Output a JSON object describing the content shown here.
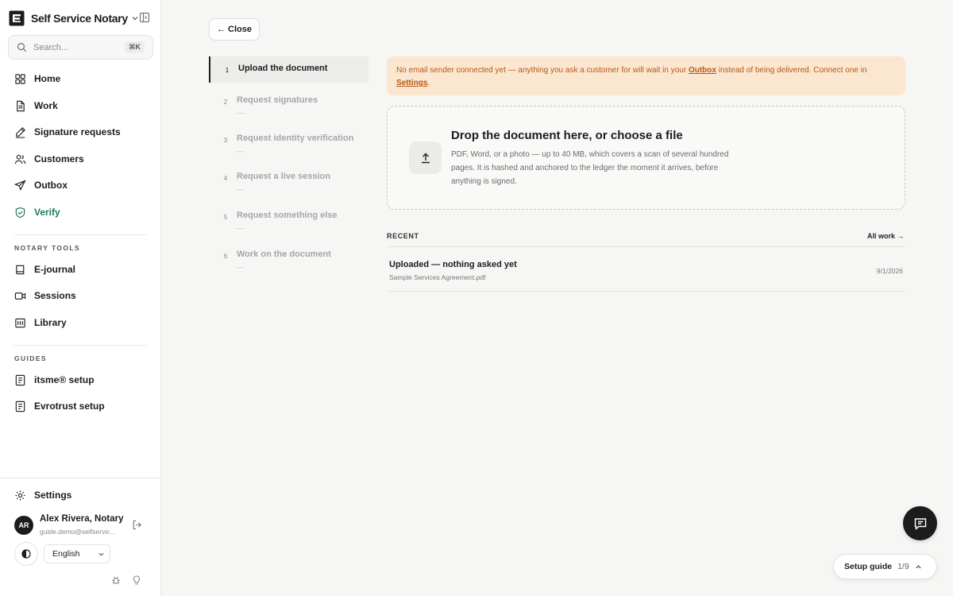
{
  "brand": {
    "name": "Self Service Notary",
    "icon": "brand-logo-icon"
  },
  "search": {
    "placeholder": "Search...",
    "shortcut": "⌘K"
  },
  "nav": {
    "main": [
      {
        "label": "Home",
        "icon": "home-grid-icon"
      },
      {
        "label": "Work",
        "icon": "document-icon"
      },
      {
        "label": "Signature requests",
        "icon": "pen-icon"
      },
      {
        "label": "Customers",
        "icon": "users-icon"
      },
      {
        "label": "Outbox",
        "icon": "send-icon"
      },
      {
        "label": "Verify",
        "icon": "shield-check-icon",
        "active": true
      }
    ],
    "tools_label": "NOTARY TOOLS",
    "tools": [
      {
        "label": "E-journal",
        "icon": "book-icon"
      },
      {
        "label": "Sessions",
        "icon": "video-icon"
      },
      {
        "label": "Library",
        "icon": "library-icon"
      }
    ],
    "guides_label": "GUIDES",
    "guides": [
      {
        "label": "itsme® setup",
        "icon": "guide-icon"
      },
      {
        "label": "Evrotrust setup",
        "icon": "guide-icon"
      }
    ],
    "settings": {
      "label": "Settings",
      "icon": "gear-icon"
    }
  },
  "user": {
    "initials": "AR",
    "name": "Alex Rivera, Notary",
    "email": "guide.demo@selfservice.notary"
  },
  "language": {
    "selected": "English"
  },
  "close_label": "← Close",
  "steps": [
    {
      "num": "1",
      "title": "Upload the document",
      "active": true
    },
    {
      "num": "2",
      "title": "Request signatures",
      "sub": "—"
    },
    {
      "num": "3",
      "title": "Request identity verification",
      "sub": "—"
    },
    {
      "num": "4",
      "title": "Request a live session",
      "sub": "—"
    },
    {
      "num": "5",
      "title": "Request something else",
      "sub": "—"
    },
    {
      "num": "6",
      "title": "Work on the document",
      "sub": "—"
    }
  ],
  "banner": {
    "text_before": "No email sender connected yet — anything you ask a customer for will wait in your ",
    "outbox_link": "Outbox",
    "text_middle": " instead of being delivered. Connect one in ",
    "settings_link": "Settings",
    "text_after": "."
  },
  "dropzone": {
    "title": "Drop the document here, or choose a file",
    "description": "PDF, Word, or a photo — up to 40 MB, which covers a scan of several hundred pages. It is hashed and anchored to the ledger the moment it arrives, before anything is signed."
  },
  "recent": {
    "label": "RECENT",
    "all_work": "All work →",
    "items": [
      {
        "title": "Uploaded — nothing asked yet",
        "file": "Sample Services Agreement.pdf",
        "date": "9/1/2026"
      }
    ]
  },
  "setup_guide": {
    "label": "Setup guide",
    "count": "1/9"
  },
  "colors": {
    "accent_green": "#1f7a5c",
    "banner_bg": "#fbe6cf",
    "banner_text": "#b35a17"
  }
}
